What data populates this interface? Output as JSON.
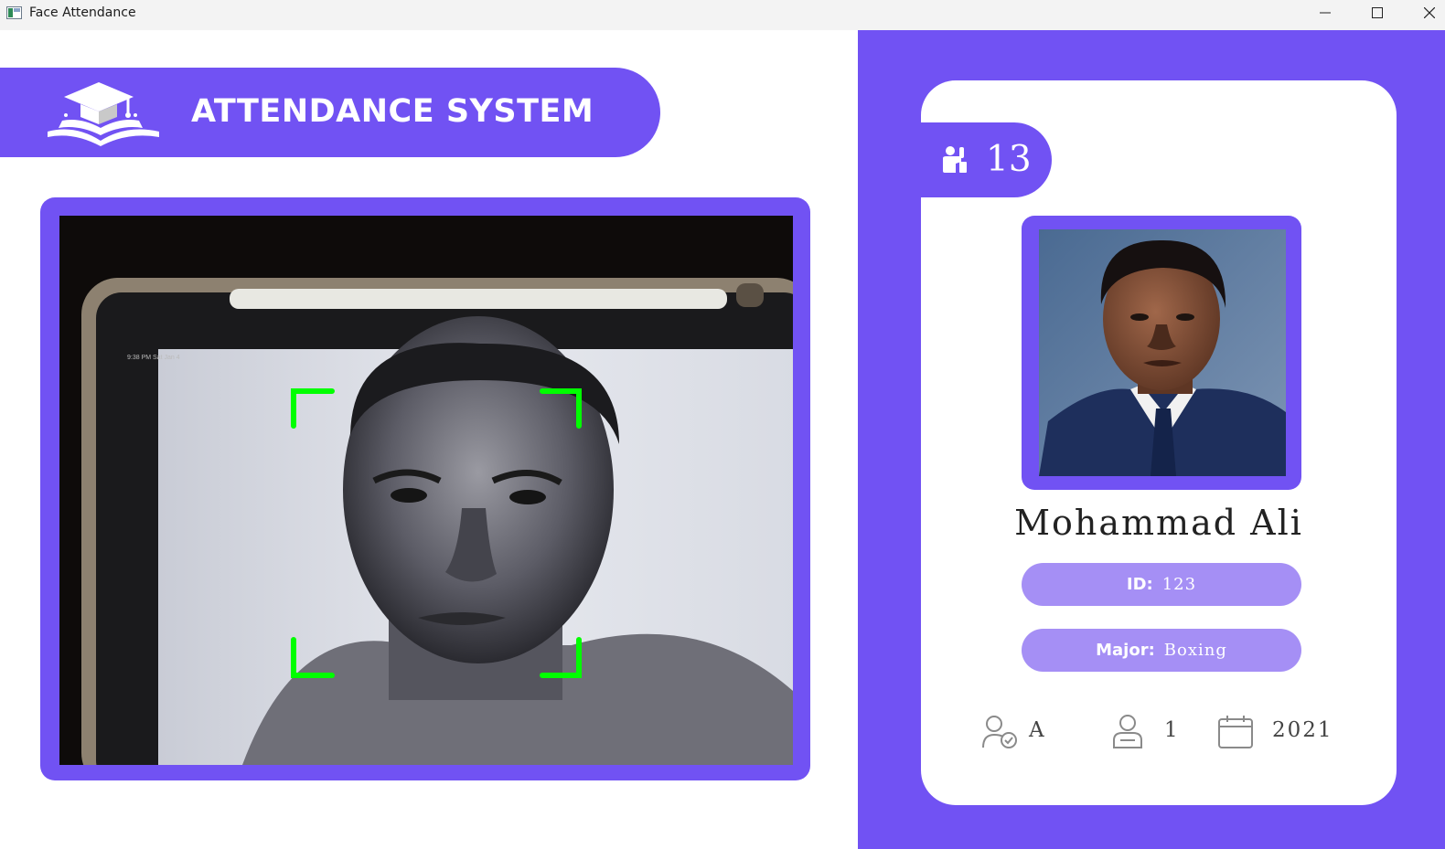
{
  "window": {
    "title": "Face Attendance",
    "app_icon": "window-app-icon",
    "controls": [
      "minimize-icon",
      "maximize-icon",
      "close-icon"
    ]
  },
  "colors": {
    "accent": "#7152f3",
    "pill": "#a58ff5",
    "scan_corners": "#00ff00",
    "card": "#ffffff"
  },
  "header": {
    "title": "ATTENDANCE SYSTEM",
    "logo_icon": "graduation-cap-book-icon"
  },
  "camera": {
    "feed": "live-webcam-feed",
    "face_detection_box": "visible"
  },
  "student": {
    "total_attendance": "13",
    "attendance_icon": "raised-hand-person-icon",
    "name": "Mohammad Ali",
    "id_label": "ID:",
    "id_value": "123",
    "major_label": "Major:",
    "major_value": "Boxing",
    "standing": "A",
    "standing_icon": "user-check-icon",
    "year": "1",
    "year_icon": "student-user-icon",
    "starting_year": "2021",
    "starting_year_icon": "calendar-icon"
  }
}
